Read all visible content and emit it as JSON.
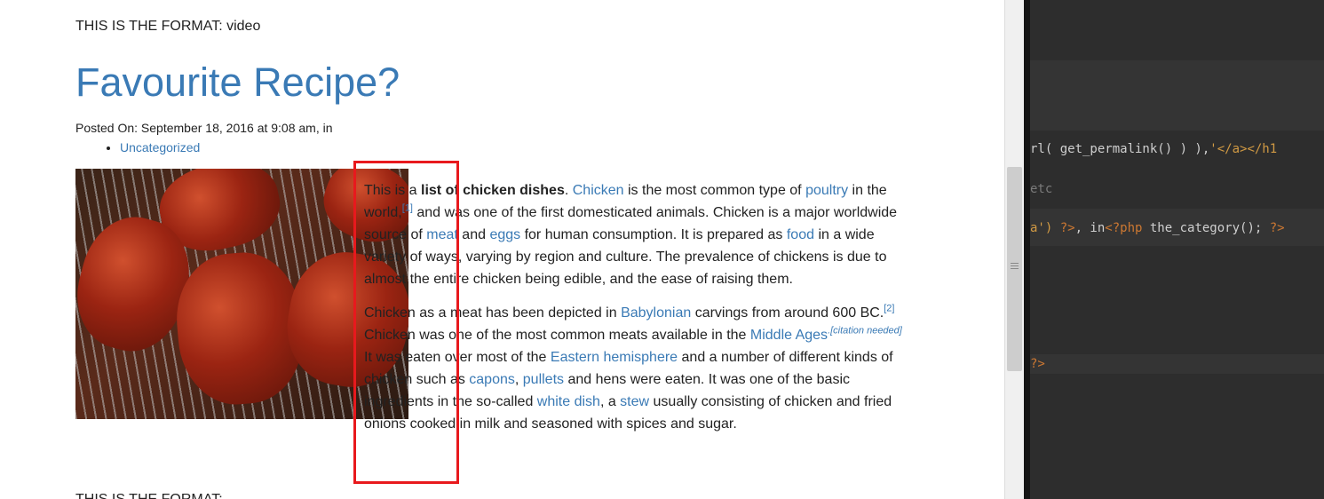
{
  "page": {
    "format_label_top": "THIS IS THE FORMAT: video",
    "format_label_bottom": "THIS IS THE FORMAT:",
    "post": {
      "title": "Favourite Recipe?",
      "meta": "Posted On: September 18, 2016 at 9:08 am, in",
      "category": "Uncategorized",
      "p1": {
        "t1": "This is a ",
        "bold": "list of chicken dishes",
        "t2": ". ",
        "l_chicken": "Chicken",
        "t3": " is the most common type of ",
        "l_poultry": "poultry",
        "t4": " in the world,",
        "ref1": "[1]",
        "t5": " and was one of the first domesticated animals. Chicken is a major worldwide source of ",
        "l_meat": "meat",
        "t6": " and ",
        "l_eggs": "eggs",
        "t7": " for human consumption. It is prepared as ",
        "l_food": "food",
        "t8": " in a wide variety of ways, varying by region and culture. The prevalence of chickens is due to almost the entire chicken being edible, and the ease of raising them."
      },
      "p2": {
        "t1": "Chicken as a meat has been depicted in ",
        "l_babylonian": "Babylonian",
        "t2": " carvings from around 600 BC.",
        "ref2": "[2]",
        "t3": " Chicken was one of the most common meats available in the ",
        "l_middle_ages": "Middle Ages",
        "cn": ".[citation needed]",
        "t4": " It was eaten over most of the ",
        "l_eastern": "Eastern hemisphere",
        "t5": " and a number of different kinds of chicken such as ",
        "l_capons": "capons",
        "t6": ", ",
        "l_pullets": "pullets",
        "t7": " and hens were eaten. It was one of the basic ingredients in the so-called ",
        "l_white_dish": "white dish",
        "t8": ", a ",
        "l_stew": "stew",
        "t9": " usually consisting of chicken and fried onions cooked in milk and seasoned with spices and sugar."
      }
    }
  },
  "editor": {
    "line1": {
      "plain": "rl( get_permalink() ) ),",
      "str": "'</a></h1"
    },
    "line2": {
      "dim": "etc"
    },
    "line3": {
      "str1": "a') ",
      "kw1": "?>",
      "plain": ", in",
      "kw2": "<?php",
      "plain2": " the_category(); ",
      "kw3": "?>"
    },
    "line4": {
      "kw": "?>"
    }
  },
  "colors": {
    "link": "#3a7ab5",
    "highlight_box": "#e8191d",
    "editor_bg": "#2d2d2d",
    "php_keyword": "#cc7832"
  }
}
